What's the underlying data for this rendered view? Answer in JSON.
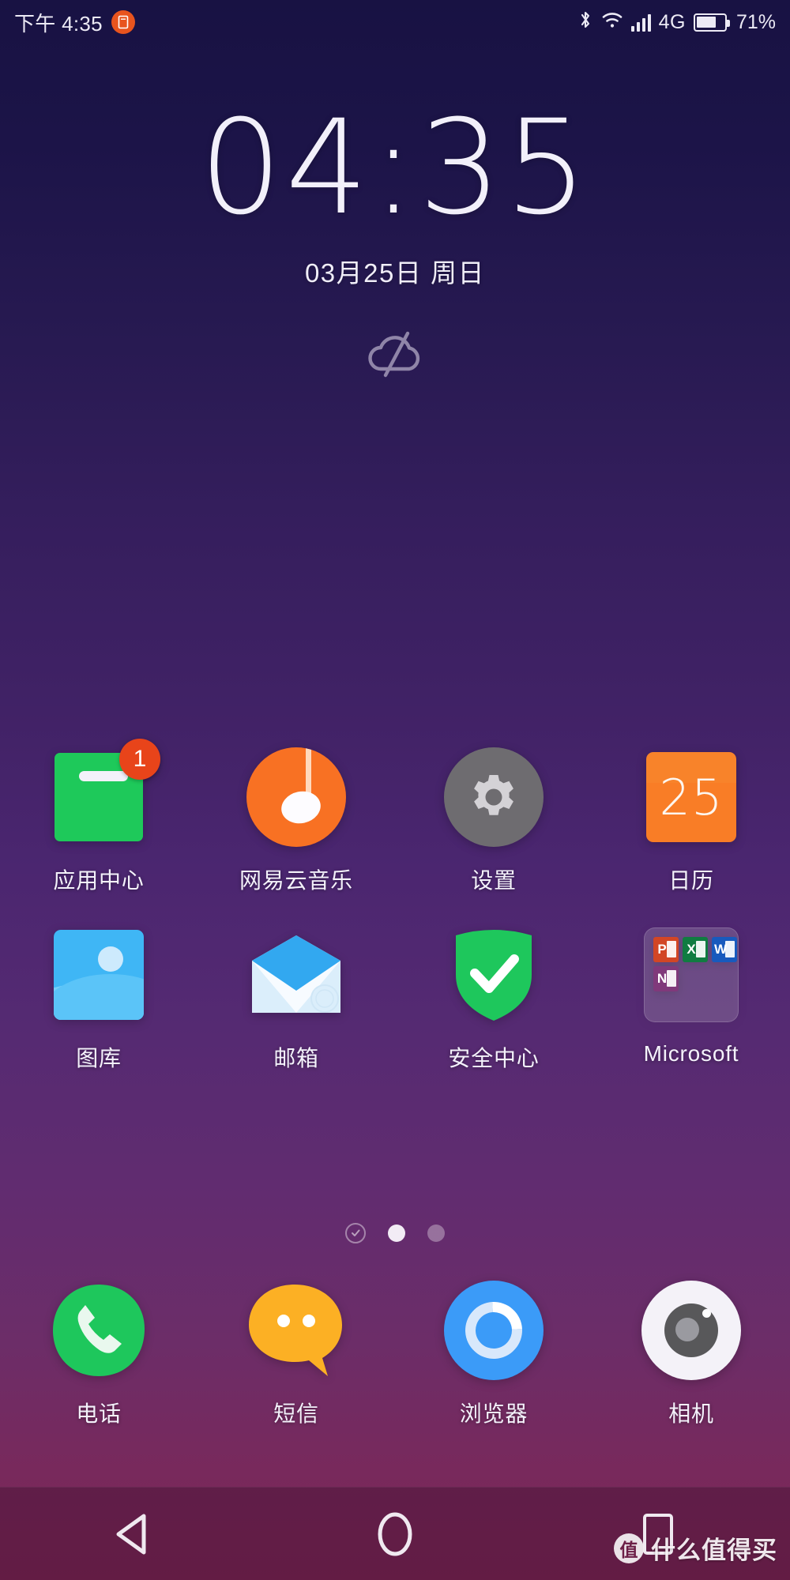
{
  "status_bar": {
    "time": "下午 4:35",
    "notification_icon": "screenshot-notification-icon",
    "bluetooth_icon": "bluetooth-icon",
    "wifi_icon": "wifi-icon",
    "signal_icon": "cellular-signal-icon",
    "network_type": "4G",
    "battery_icon": "battery-icon",
    "battery_percent": "71%",
    "battery_level": 71,
    "notification_badge_color": "#e8541e"
  },
  "clock_widget": {
    "time": "04:35",
    "date": "03月25日  周日",
    "weather_icon": "cloud-slash-no-data-icon"
  },
  "home_screen": {
    "rows": [
      {
        "id": "row-1",
        "apps": [
          {
            "label": "应用中心",
            "icon": "app-center-icon",
            "badge": "1"
          },
          {
            "label": "网易云音乐",
            "icon": "netease-cloud-music-icon",
            "badge": ""
          },
          {
            "label": "设置",
            "icon": "settings-gear-icon",
            "badge": ""
          },
          {
            "label": "日历",
            "icon": "calendar-icon",
            "badge": "",
            "icon_text": "25"
          }
        ]
      },
      {
        "id": "row-2",
        "apps": [
          {
            "label": "图库",
            "icon": "gallery-icon",
            "badge": ""
          },
          {
            "label": "邮箱",
            "icon": "email-envelope-icon",
            "badge": ""
          },
          {
            "label": "安全中心",
            "icon": "security-shield-icon",
            "badge": ""
          },
          {
            "label": "Microsoft",
            "icon": "microsoft-folder-icon",
            "badge": ""
          }
        ]
      }
    ],
    "folder_microsoft": {
      "apps": [
        {
          "name": "PowerPoint",
          "letter": "P",
          "color": "#d24625"
        },
        {
          "name": "Excel",
          "letter": "X",
          "color": "#107c41"
        },
        {
          "name": "Word",
          "letter": "W",
          "color": "#185abd"
        },
        {
          "name": "OneNote",
          "letter": "N",
          "color": "#80397b"
        }
      ]
    },
    "page_indicator": {
      "dots": [
        "check",
        "active",
        "inactive"
      ],
      "current_page": 2,
      "total_pages": 3
    },
    "dock": {
      "apps": [
        {
          "label": "电话",
          "icon": "phone-handset-icon"
        },
        {
          "label": "短信",
          "icon": "sms-bubble-icon"
        },
        {
          "label": "浏览器",
          "icon": "browser-ring-icon"
        },
        {
          "label": "相机",
          "icon": "camera-lens-icon"
        }
      ]
    }
  },
  "nav_bar": {
    "back": "back-triangle-icon",
    "home": "home-circle-icon",
    "recents": "recents-square-icon"
  },
  "watermark": {
    "logo_char": "值",
    "text": "什么值得买"
  },
  "colors": {
    "bg_top": "#181243",
    "bg_mid": "#4b2670",
    "bg_bottom": "#7d2654",
    "accent_orange": "#f8832a",
    "accent_green": "#1ec95a",
    "accent_blue": "#3b9bf8",
    "badge_red": "#e8441a"
  }
}
